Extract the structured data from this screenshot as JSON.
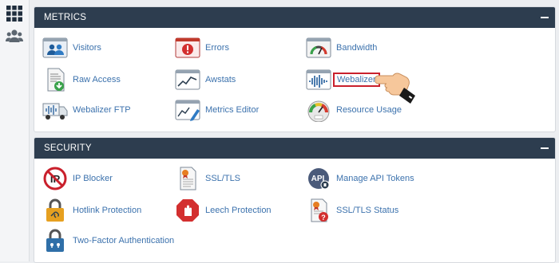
{
  "sidebar": {
    "items": [
      {
        "name": "apps-grid-icon"
      },
      {
        "name": "users-icon"
      }
    ]
  },
  "metrics": {
    "title": "METRICS",
    "items": [
      {
        "label": "Visitors",
        "icon": "visitors-icon"
      },
      {
        "label": "Errors",
        "icon": "errors-icon"
      },
      {
        "label": "Bandwidth",
        "icon": "bandwidth-icon"
      },
      {
        "label": "Raw Access",
        "icon": "raw-access-icon"
      },
      {
        "label": "Awstats",
        "icon": "awstats-icon"
      },
      {
        "label": "Webalizer",
        "icon": "webalizer-icon",
        "highlighted": true
      },
      {
        "label": "Webalizer FTP",
        "icon": "webalizer-ftp-icon"
      },
      {
        "label": "Metrics Editor",
        "icon": "metrics-editor-icon"
      },
      {
        "label": "Resource Usage",
        "icon": "resource-usage-icon"
      }
    ]
  },
  "security": {
    "title": "SECURITY",
    "items": [
      {
        "label": "IP Blocker",
        "icon": "ip-blocker-icon"
      },
      {
        "label": "SSL/TLS",
        "icon": "ssl-tls-icon"
      },
      {
        "label": "Manage API Tokens",
        "icon": "api-tokens-icon"
      },
      {
        "label": "Hotlink Protection",
        "icon": "hotlink-protection-icon"
      },
      {
        "label": "Leech Protection",
        "icon": "leech-protection-icon"
      },
      {
        "label": "SSL/TLS Status",
        "icon": "ssl-tls-status-icon"
      },
      {
        "label": "Two-Factor Authentication",
        "icon": "two-factor-auth-icon"
      }
    ]
  },
  "colors": {
    "header": "#2d3d4f",
    "link": "#3c72ad",
    "highlight": "#c9202c"
  }
}
